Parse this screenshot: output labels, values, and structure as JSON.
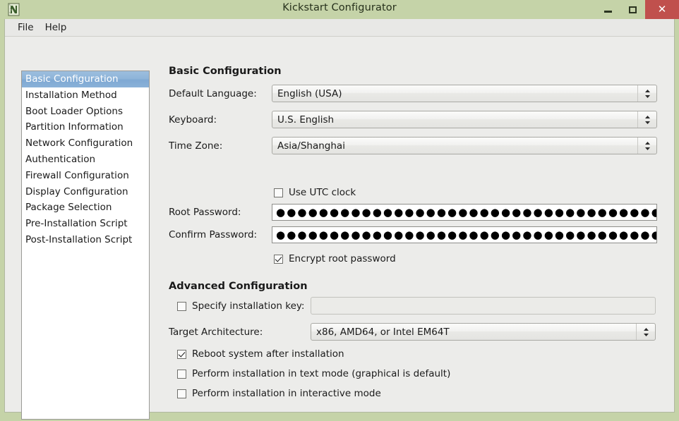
{
  "window": {
    "title": "Kickstart Configurator",
    "icon": "app-icon",
    "controls": {
      "minimize": "–",
      "maximize": "□",
      "close": "✕"
    },
    "colors": {
      "titlebar": "#c5d3a8",
      "close_button": "#c0504d",
      "selection": "#8db3d9",
      "content_bg": "#ececea",
      "entry_bg": "#ffffff"
    }
  },
  "menubar": {
    "items": [
      {
        "label": "File"
      },
      {
        "label": "Help"
      }
    ]
  },
  "sidebar": {
    "selected_index": 0,
    "items": [
      {
        "label": "Basic Configuration"
      },
      {
        "label": "Installation Method"
      },
      {
        "label": "Boot Loader Options"
      },
      {
        "label": "Partition Information"
      },
      {
        "label": "Network Configuration"
      },
      {
        "label": "Authentication"
      },
      {
        "label": "Firewall Configuration"
      },
      {
        "label": "Display Configuration"
      },
      {
        "label": "Package Selection"
      },
      {
        "label": "Pre-Installation Script"
      },
      {
        "label": "Post-Installation Script"
      }
    ]
  },
  "basic": {
    "heading": "Basic Configuration",
    "language": {
      "label": "Default Language:",
      "value": "English (USA)"
    },
    "keyboard": {
      "label": "Keyboard:",
      "value": "U.S. English"
    },
    "timezone": {
      "label": "Time Zone:",
      "value": "Asia/Shanghai"
    },
    "utc": {
      "label": "Use UTC clock",
      "checked": false
    },
    "root_password": {
      "label": "Root Password:",
      "value": "●●●●●●●●●●●●●●●●●●●●●●●●●●●●●●●●●●●●●●●●●●●●"
    },
    "confirm_password": {
      "label": "Confirm Password:",
      "value": "●●●●●●●●●●●●●●●●●●●●●●●●●●●●●●●●●●●●●●●●●●●●"
    },
    "encrypt": {
      "label": "Encrypt root password",
      "checked": true
    }
  },
  "advanced": {
    "heading": "Advanced Configuration",
    "install_key": {
      "label": "Specify installation key:",
      "checked": false,
      "value": "",
      "placeholder": ""
    },
    "architecture": {
      "label": "Target Architecture:",
      "value": "x86, AMD64, or Intel EM64T"
    },
    "reboot": {
      "label": "Reboot system after installation",
      "checked": true
    },
    "text_mode": {
      "label": "Perform installation in text mode (graphical is default)",
      "checked": false
    },
    "interactive_mode": {
      "label": "Perform installation in interactive mode",
      "checked": false
    }
  }
}
